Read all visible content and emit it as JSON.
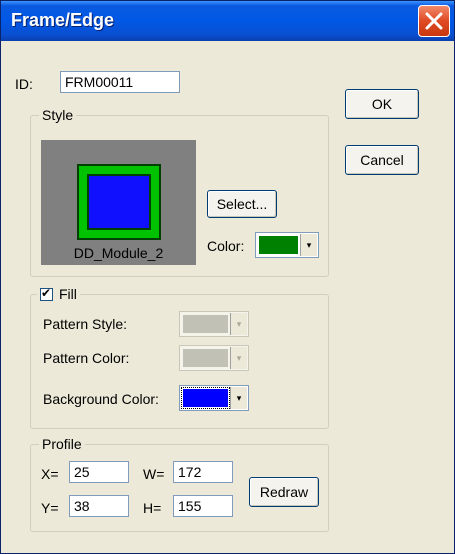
{
  "window": {
    "title": "Frame/Edge"
  },
  "id_field": {
    "label": "ID:",
    "value": "FRM00011"
  },
  "style": {
    "legend": "Style",
    "preview_label": "DD_Module_2",
    "select_button": "Select...",
    "color_label": "Color:",
    "color_value": "#008000"
  },
  "fill": {
    "legend": "Fill",
    "checked": true,
    "check_glyph": "✔",
    "pattern_style_label": "Pattern Style:",
    "pattern_color_label": "Pattern Color:",
    "background_color_label": "Background Color:",
    "background_color_value": "#0000ff",
    "disabled_swatch_color": "#c2c1b6"
  },
  "profile": {
    "legend": "Profile",
    "x_label": "X=",
    "x_value": "25",
    "y_label": "Y=",
    "y_value": "38",
    "w_label": "W=",
    "w_value": "172",
    "h_label": "H=",
    "h_value": "155",
    "redraw_button": "Redraw"
  },
  "buttons": {
    "ok": "OK",
    "cancel": "Cancel"
  },
  "arrow_glyph": "▾"
}
